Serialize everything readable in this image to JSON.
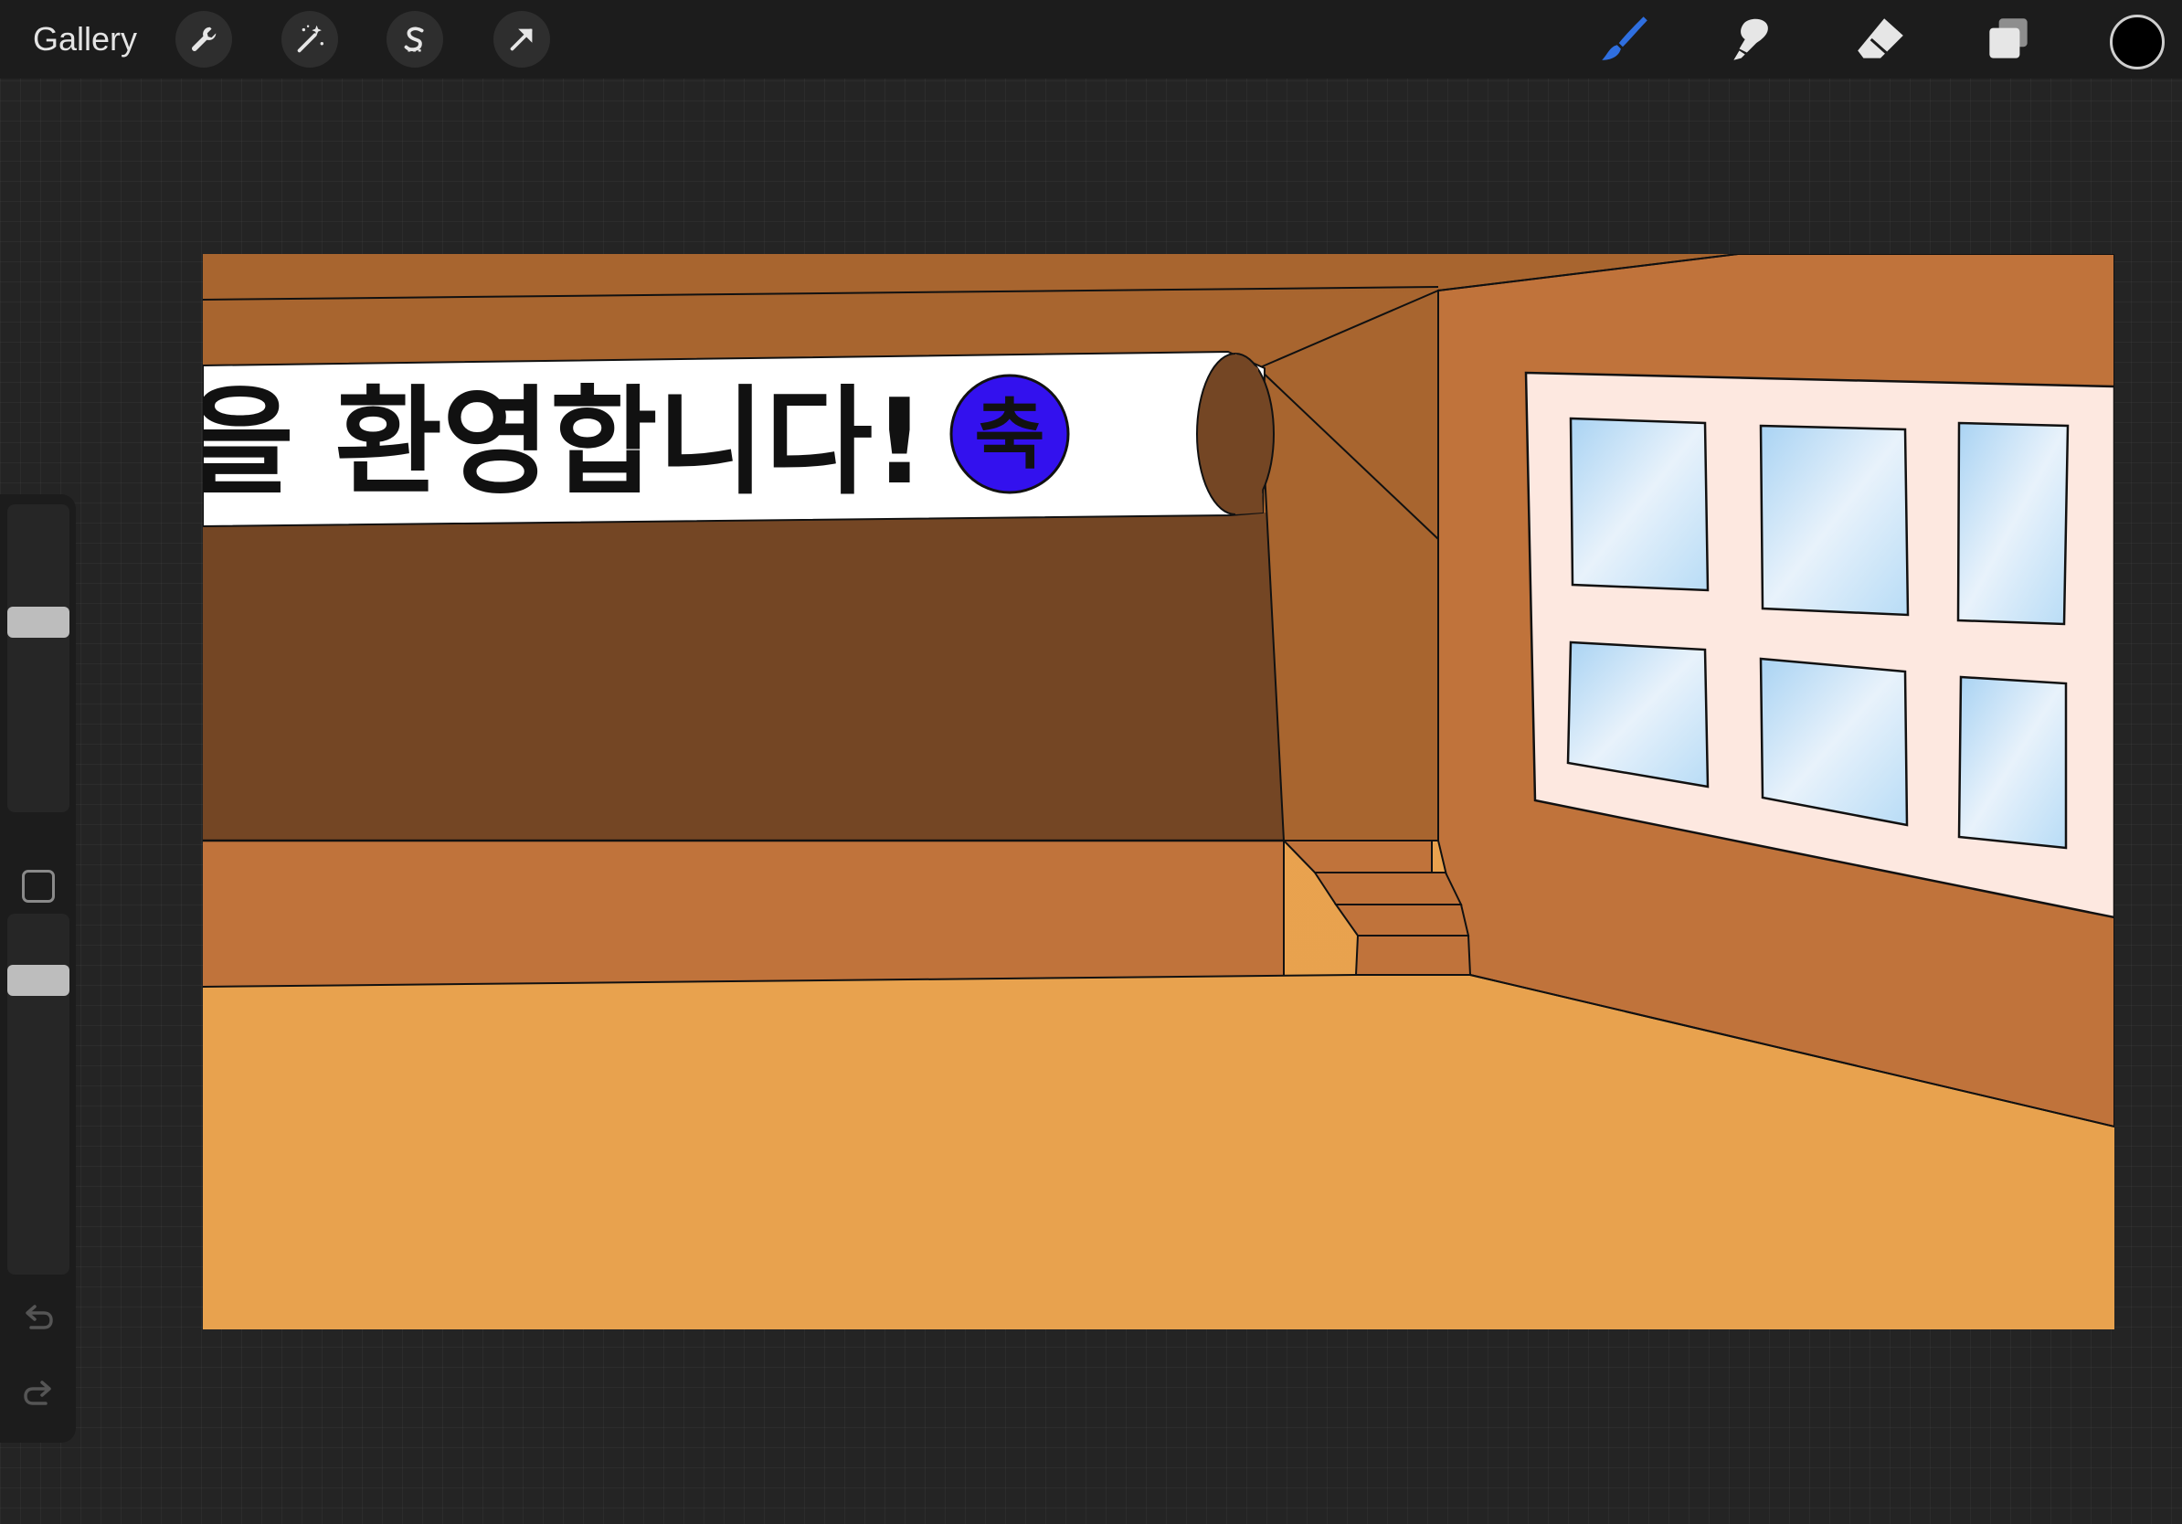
{
  "toolbar": {
    "gallery_label": "Gallery",
    "left_tools": [
      {
        "name": "actions",
        "icon": "wrench-icon"
      },
      {
        "name": "adjustments",
        "icon": "magic-wand-icon"
      },
      {
        "name": "selection",
        "icon": "selection-s-icon"
      },
      {
        "name": "transform",
        "icon": "arrow-cursor-icon"
      }
    ],
    "right_tools": [
      {
        "name": "brush",
        "icon": "brush-icon",
        "active": true,
        "color": "#2f6fe0"
      },
      {
        "name": "smudge",
        "icon": "smudge-finger-icon",
        "active": false
      },
      {
        "name": "eraser",
        "icon": "eraser-icon",
        "active": false
      },
      {
        "name": "layers",
        "icon": "layers-icon",
        "active": false
      }
    ],
    "current_color": "#000000"
  },
  "sidebar": {
    "brush_size_level": 0.6,
    "brush_opacity_level": 0.98,
    "modify_icon": "square-icon",
    "undo_icon": "undo-arrow-icon",
    "redo_icon": "redo-arrow-icon"
  },
  "artwork": {
    "banner_text": "을 환영합니다!",
    "badge_text": "축",
    "badge_color": "#3311ee",
    "wall_color": "#a8652f",
    "shadow_color": "#744624",
    "floor_color": "#e9a24f",
    "window_frame_color": "#fde8e0",
    "sky_color": "#bfe0f7"
  }
}
